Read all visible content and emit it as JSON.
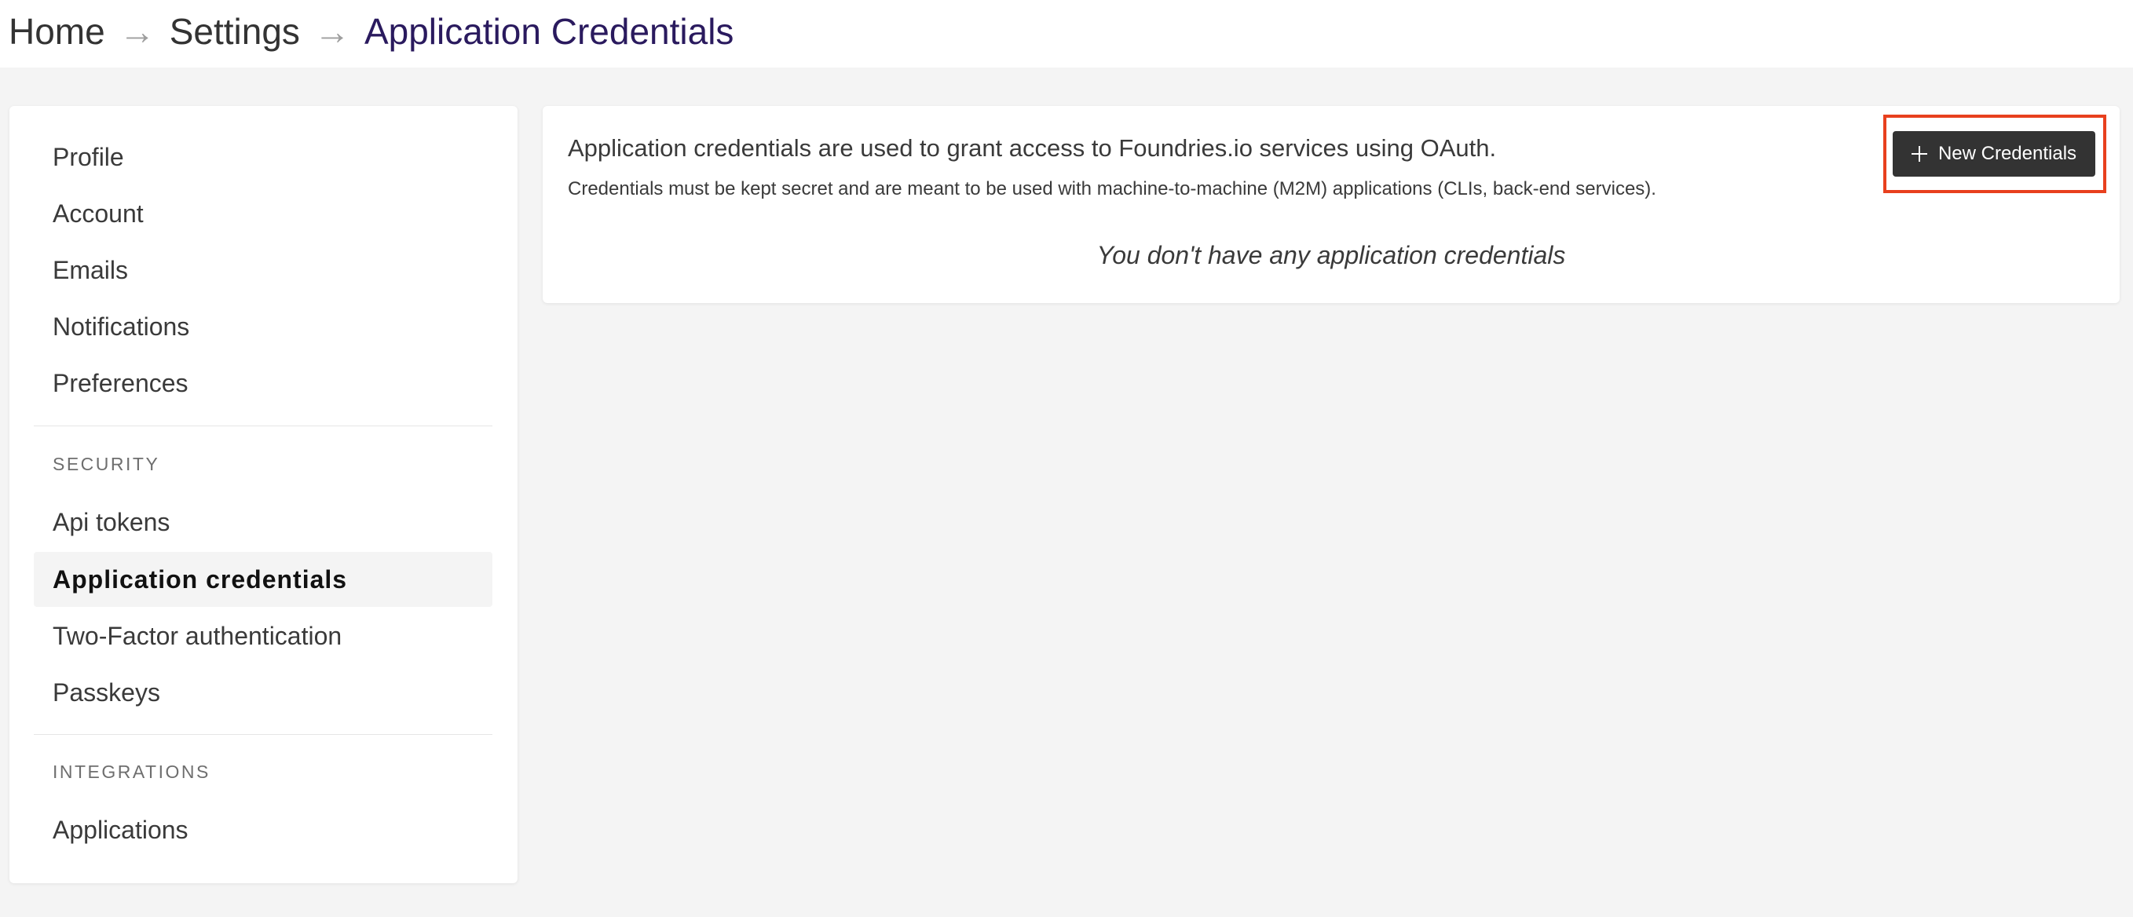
{
  "breadcrumb": {
    "home": "Home",
    "settings": "Settings",
    "current": "Application Credentials",
    "separator": "→"
  },
  "sidebar": {
    "items": [
      {
        "label": "Profile"
      },
      {
        "label": "Account"
      },
      {
        "label": "Emails"
      },
      {
        "label": "Notifications"
      },
      {
        "label": "Preferences"
      }
    ],
    "security": {
      "title": "SECURITY",
      "items": [
        {
          "label": "Api tokens"
        },
        {
          "label": "Application credentials",
          "active": true
        },
        {
          "label": "Two-Factor authentication"
        },
        {
          "label": "Passkeys"
        }
      ]
    },
    "integrations": {
      "title": "INTEGRATIONS",
      "items": [
        {
          "label": "Applications"
        }
      ]
    }
  },
  "main": {
    "title": "Application credentials are used to grant access to Foundries.io services using OAuth.",
    "description": "Credentials must be kept secret and are meant to be used with machine-to-machine (M2M) applications (CLIs, back-end services).",
    "empty_message": "You don't have any application credentials",
    "new_button_label": "New Credentials",
    "new_button_icon": "plus-icon",
    "highlight_color": "#e8401e"
  },
  "colors": {
    "page_background": "#f4f4f4",
    "breadcrumb_current": "#2a1a5e",
    "button_background": "#333333"
  }
}
